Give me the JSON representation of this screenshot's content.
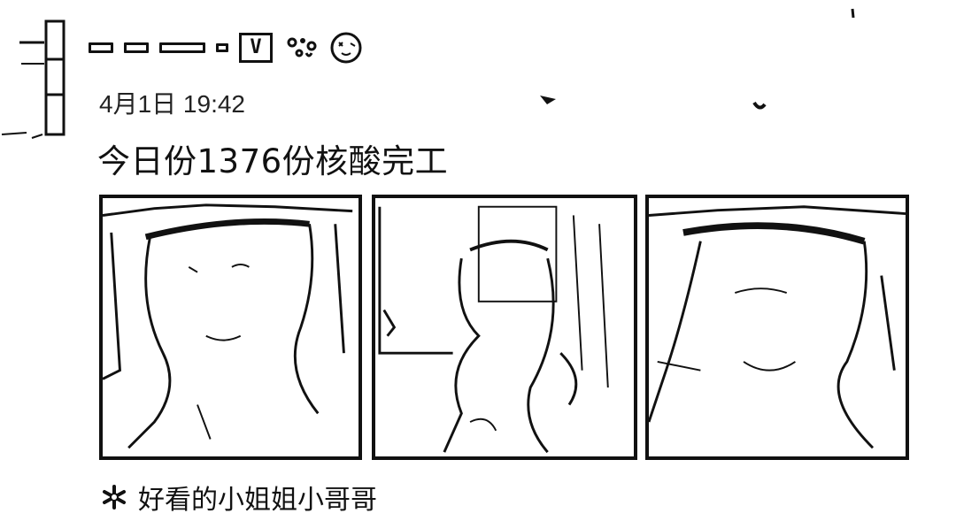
{
  "post": {
    "timestamp": "4月1日 19:42",
    "text": "今日份1376份核酸完工",
    "badge_letter": "V",
    "images_count": 3
  },
  "footer": {
    "topic_text": "好看的小姐姐小哥哥"
  },
  "icons": {
    "badge": "vip-badge-icon",
    "dots": "dots-icon",
    "face": "smiley-face-icon",
    "topic": "topic-asterisk-icon"
  },
  "colors": {
    "background": "#ffffff",
    "ink": "#111111"
  }
}
